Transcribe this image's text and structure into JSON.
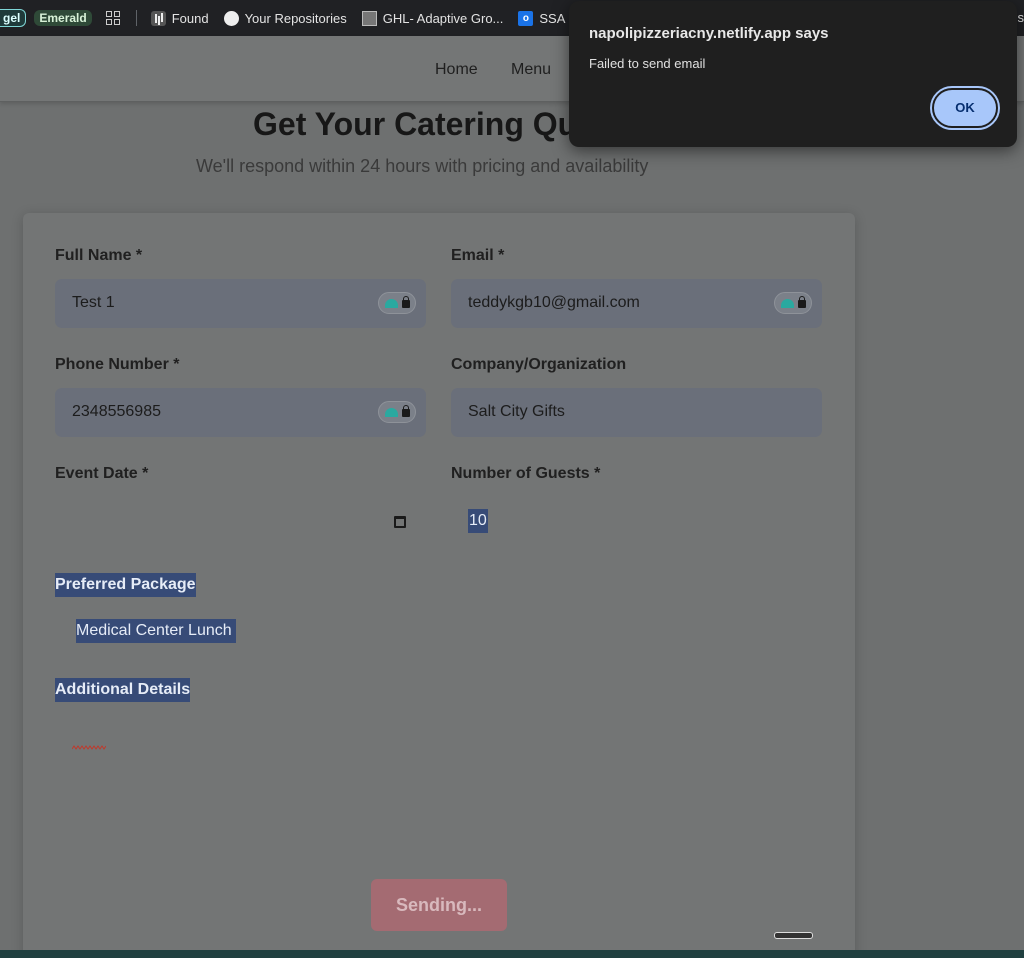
{
  "bookmarks": {
    "chip1": "gel",
    "chip2": "Emerald",
    "items": [
      "Found",
      "Your Repositories",
      "GHL- Adaptive Gro...",
      "SSA Ma"
    ],
    "right_edge": "s"
  },
  "nav": {
    "home": "Home",
    "menu": "Menu"
  },
  "hero": {
    "title": "Get Your Catering Qu",
    "subtitle": "We'll respond within 24 hours with pricing and availability"
  },
  "form": {
    "full_name": {
      "label": "Full Name *",
      "value": "Test 1"
    },
    "email": {
      "label": "Email *",
      "value": "teddykgb10@gmail.com"
    },
    "phone": {
      "label": "Phone Number *",
      "value": "2348556985"
    },
    "company": {
      "label": "Company/Organization",
      "value": "Salt City Gifts"
    },
    "event_date": {
      "label": "Event Date *",
      "value": ""
    },
    "guests": {
      "label": "Number of Guests *",
      "value": "10"
    },
    "package": {
      "label": "Preferred Package",
      "value": "Medical Center Lunch"
    },
    "details": {
      "label": "Additional Details",
      "value": ""
    },
    "submit_label": "Sending..."
  },
  "dialog": {
    "title": "napolipizzeriacny.netlify.app says",
    "message": "Failed to send email",
    "ok_label": "OK"
  },
  "colors": {
    "overlay_page": "#6e7070",
    "dialog_bg": "#1f1f1f",
    "ok_button": "#a8c7fa",
    "selection": "#374b77"
  }
}
